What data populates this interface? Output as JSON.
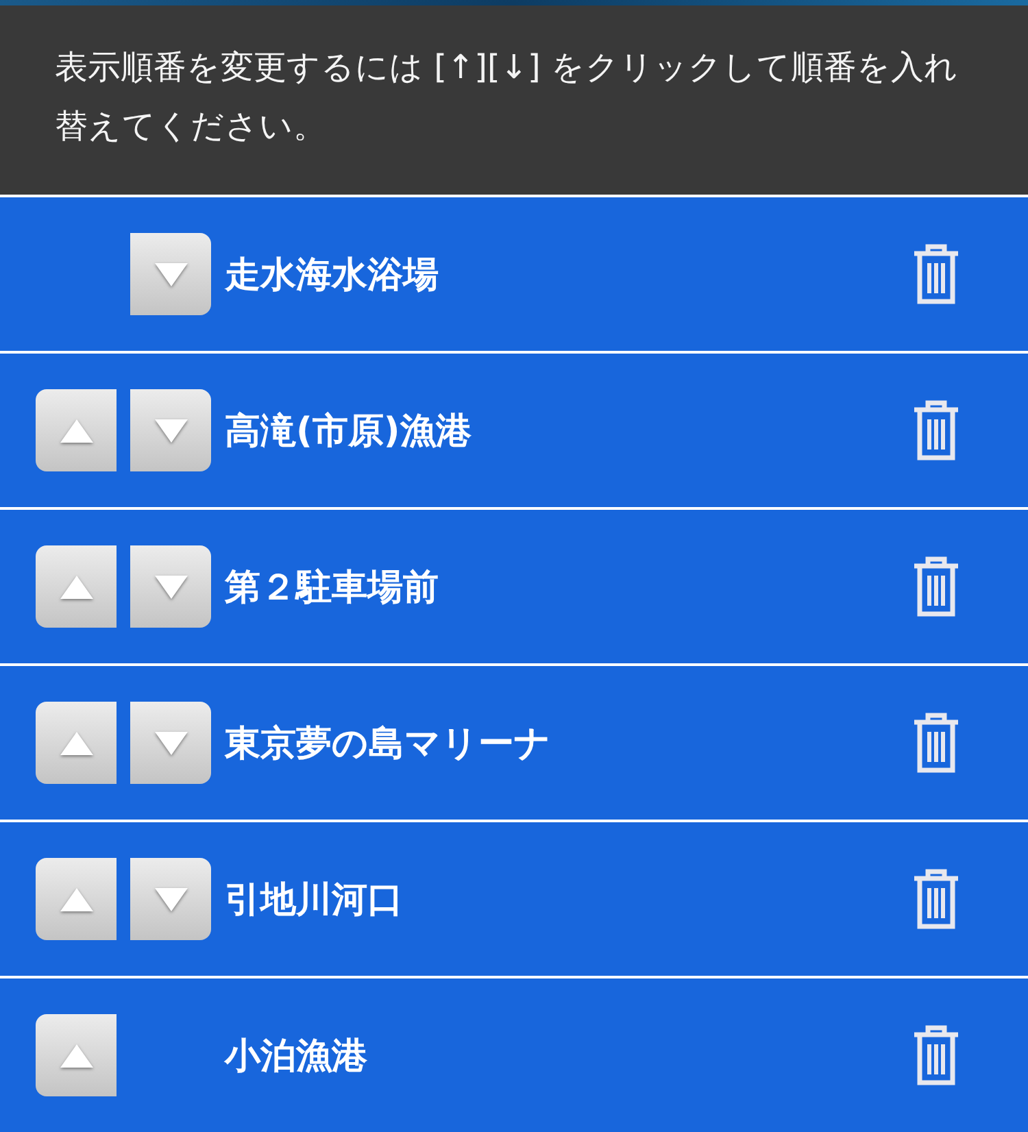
{
  "instructions": "表示順番を変更するには [↑][↓] をクリックして順番を入れ替えてください。",
  "rows": [
    {
      "name": "走水海水浴場",
      "can_move_up": false,
      "can_move_down": true
    },
    {
      "name": "高滝(市原)漁港",
      "can_move_up": true,
      "can_move_down": true
    },
    {
      "name": "第２駐車場前",
      "can_move_up": true,
      "can_move_down": true
    },
    {
      "name": "東京夢の島マリーナ",
      "can_move_up": true,
      "can_move_down": true
    },
    {
      "name": "引地川河口",
      "can_move_up": true,
      "can_move_down": true
    },
    {
      "name": "小泊漁港",
      "can_move_up": true,
      "can_move_down": false
    }
  ]
}
